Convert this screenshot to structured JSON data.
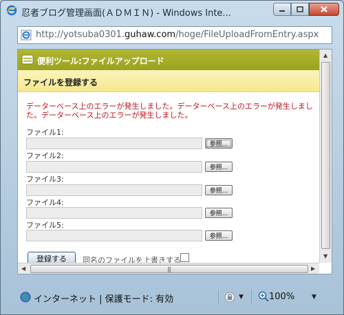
{
  "window": {
    "title": "忍者ブログ管理画面(ＡＤＭＩＮ) - Windows Inte...",
    "url_prefix": "http://yotsuba0301.",
    "url_domain": "guhaw.com",
    "url_suffix": "/hoge/FileUploadFromEntry.aspx"
  },
  "tool": {
    "title": "便利ツール:ファイルアップロード",
    "section_title": "ファイルを登録する",
    "error_message": "データーベース上のエラーが発生しました。データーベース上のエラーが発生しました。データーベース上のエラーが発生しました。",
    "files": [
      {
        "label": "ファイル1:",
        "button": "参照..."
      },
      {
        "label": "ファイル2:",
        "button": "参照..."
      },
      {
        "label": "ファイル3:",
        "button": "参照..."
      },
      {
        "label": "ファイル4:",
        "button": "参照..."
      },
      {
        "label": "ファイル5:",
        "button": "参照..."
      }
    ],
    "submit_label": "登録する",
    "overwrite_label": "同名のファイルを上書きする",
    "overwrite_checked": false
  },
  "statusbar": {
    "zone": "インターネット | 保護モード: 有効",
    "zoom": "100%"
  },
  "colors": {
    "tool_header": "#a6ac28",
    "section_header": "#f8ee9f",
    "error": "#c0141d"
  }
}
